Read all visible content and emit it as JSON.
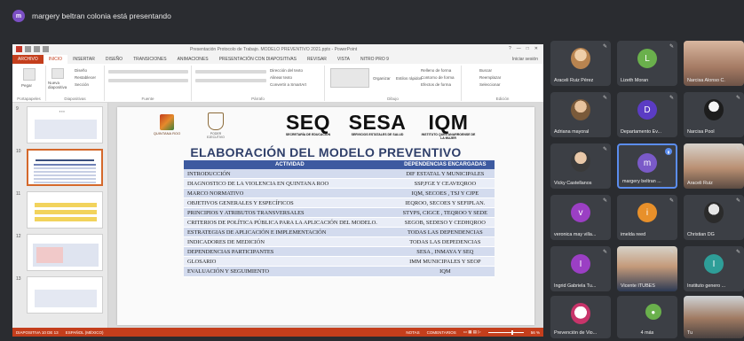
{
  "banner": {
    "avatar_letter": "m",
    "text": "margery beltran colonia está presentando"
  },
  "ppt": {
    "doc_title": "Presentación Protocolo de Trabajo. MODELO PREVENTIVO 2021.pptx - PowerPoint",
    "window_controls": [
      "?",
      "—",
      "□",
      "✕"
    ],
    "tabs": [
      "ARCHIVO",
      "INICIO",
      "INSERTAR",
      "DISEÑO",
      "TRANSICIONES",
      "ANIMACIONES",
      "PRESENTACIÓN CON DIAPOSITIVAS",
      "REVISAR",
      "VISTA",
      "NITRO PRO 9"
    ],
    "sign_in": "Iniciar sesión",
    "ribbon": {
      "paste": "Pegar",
      "clipboard": "Portapapeles",
      "new_slide": "Nueva diapositiva",
      "design": "Diseño",
      "reset": "Restablecer",
      "section": "Sección",
      "slides_group": "Diapositivas",
      "font_group": "Fuente",
      "paragraph_group": "Párrafo",
      "text_direction": "Dirección del texto",
      "align_text": "Alinear texto",
      "convert_smartart": "Convertir a SmartArt",
      "arrange": "Organizar",
      "quick_styles": "Estilos rápidos",
      "shape_fill": "Relleno de forma",
      "shape_outline": "Contorno de forma",
      "shape_effects": "Efectos de forma",
      "drawing_group": "Dibujo",
      "find": "Buscar",
      "replace": "Reemplazar",
      "select": "Seleccionar",
      "editing_group": "Edición"
    },
    "thumbnail_numbers": [
      "9",
      "10",
      "11",
      "12",
      "13"
    ],
    "status": {
      "slide_info": "DIAPOSITIVA 10 DE 13",
      "language": "ESPAÑOL (MÉXICO)",
      "notes": "NOTAS",
      "comments": "COMENTARIOS",
      "zoom": "56 %"
    }
  },
  "slide": {
    "logo_qroo": "QUINTANA ROO",
    "logo_shield": "PODER EJECUTIVO",
    "seq": {
      "big": "SEQ",
      "small": "SECRETARÍA DE EDUCACIÓN"
    },
    "sesa": {
      "big": "SESA",
      "small": "SERVICIOS ESTATALES DE SALUD"
    },
    "iqm": {
      "big": "IQM",
      "small": "INSTITUTO QUINTANARROENSE DE LA MUJER"
    },
    "title": "ELABORACIÓN DEL MODELO PREVENTIVO",
    "headers": [
      "ACTIVIDAD",
      "DEPENDENCIAS ENCARGADAS"
    ],
    "rows": [
      [
        "INTRODUCCIÓN",
        "DIF ESTATAL Y MUNICIPALES"
      ],
      [
        "DIAGNOSTICO DE LA VIOLENCIA EN QUINTANA ROO",
        "SSP,FGE Y CEAVEQROO"
      ],
      [
        "MARCO NORMATIVO",
        "IQM, SECOES , TSJ Y CJPE"
      ],
      [
        "OBJETIVOS GENERALES Y ESPECÍFICOS",
        "IEQROO, SECOES Y SEFIPLAN."
      ],
      [
        "PRINCIPIOS Y ATRIBUTOS TRANSVERSALES",
        "STYPS, CIGCE , TEQROO Y SEDE"
      ],
      [
        "CRITERIOS DE POLÍTICA PÚBLICA PARA LA APLICACIÓN DEL MODELO.",
        "SEGOB, SEDESO Y CEDHQROO"
      ],
      [
        "ESTRATEGIAS DE APLICACIÓN E IMPLEMENTACIÓN",
        "TODAS LAS DEPENDENCIAS"
      ],
      [
        "INDICADORES DE MEDICIÓN",
        "TODAS LAS DEPEDENCIAS"
      ],
      [
        "DEPENDENCIAS PARTICIPANTES",
        "SESA , INMAYA Y SEQ"
      ],
      [
        "GLOSARIO",
        "IMM MUNICIPALES Y SEOP"
      ],
      [
        "EVALUACIÓN Y SEGUIMIENTO",
        "IQM"
      ]
    ]
  },
  "participants": [
    {
      "name": "Araceli Ruiz Pérez",
      "kind": "photo"
    },
    {
      "name": "Lizeth Moran",
      "kind": "letter",
      "letter": "L",
      "color": "#6ab04c"
    },
    {
      "name": "Narcisa Alonso C.",
      "kind": "video"
    },
    {
      "name": "Adriana mayoral",
      "kind": "photo"
    },
    {
      "name": "Departamento Ev...",
      "kind": "letter",
      "letter": "D",
      "color": "#5b3cc4"
    },
    {
      "name": "Narcisa Pool",
      "kind": "photo"
    },
    {
      "name": "Vicky Castellanos",
      "kind": "photo"
    },
    {
      "name": "margery beltran ...",
      "kind": "letter",
      "letter": "m",
      "color": "#7a5ac8"
    },
    {
      "name": "Araceli Ruiz",
      "kind": "video"
    },
    {
      "name": "veronica may villa...",
      "kind": "letter",
      "letter": "v",
      "color": "#9b3fc4"
    },
    {
      "name": "imelda reed",
      "kind": "letter",
      "letter": "i",
      "color": "#e8902a"
    },
    {
      "name": "Christian DG",
      "kind": "photo"
    },
    {
      "name": "Ingrid Gabriela Tu...",
      "kind": "letter",
      "letter": "I",
      "color": "#9b3fc4"
    },
    {
      "name": "Vicente ITUBES",
      "kind": "video"
    },
    {
      "name": "Instituto genero ...",
      "kind": "letter",
      "letter": "I",
      "color": "#2e9e98"
    },
    {
      "name": "Prevención de Vio...",
      "kind": "photo"
    },
    {
      "name": "4 más",
      "kind": "more"
    },
    {
      "name": "Tu",
      "kind": "video"
    }
  ],
  "colors": {
    "ppt_accent": "#c43e1c",
    "table_header": "#3d5aa0",
    "active_speaker": "#5b8def"
  }
}
